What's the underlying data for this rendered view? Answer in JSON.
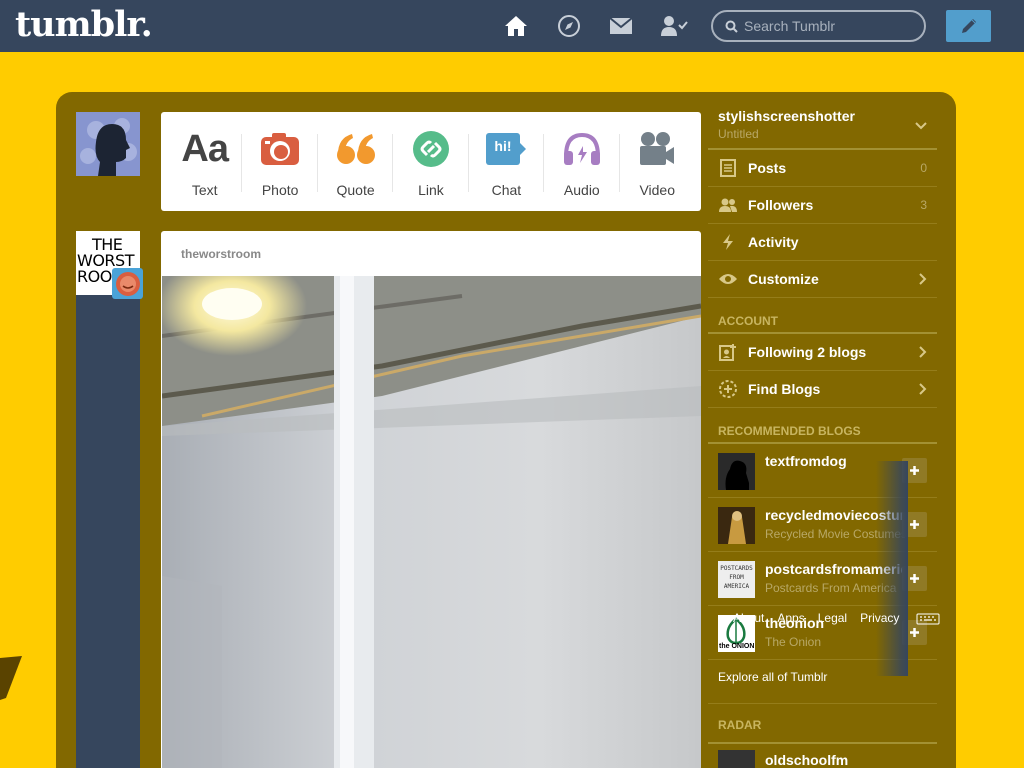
{
  "header": {
    "logo": "tumblr.",
    "search_placeholder": "Search Tumblr"
  },
  "post_types": [
    {
      "label": "Text",
      "color": "#444444"
    },
    {
      "label": "Photo",
      "color": "#d95e40"
    },
    {
      "label": "Quote",
      "color": "#f2992e"
    },
    {
      "label": "Link",
      "color": "#56bc8a"
    },
    {
      "label": "Chat",
      "color": "#529ecc"
    },
    {
      "label": "Audio",
      "color": "#a77dc2"
    },
    {
      "label": "Video",
      "color": "#748089"
    }
  ],
  "post_type_glyphs": {
    "text": "Aa",
    "chat": "hi!"
  },
  "blog_avatar_text": [
    "THE",
    "WORST",
    "ROO"
  ],
  "post": {
    "blog_name": "theworstroom"
  },
  "sidebar": {
    "account_name": "stylishscreenshotter",
    "account_sub": "Untitled",
    "rows": [
      {
        "label": "Posts",
        "count": "0"
      },
      {
        "label": "Followers",
        "count": "3"
      },
      {
        "label": "Activity",
        "count": ""
      },
      {
        "label": "Customize",
        "count": ""
      }
    ],
    "account_title": "ACCOUNT",
    "account_rows": [
      {
        "label": "Following 2 blogs"
      },
      {
        "label": "Find Blogs"
      }
    ],
    "recommended_title": "RECOMMENDED BLOGS",
    "recommended": [
      {
        "name": "textfromdog",
        "sub": ""
      },
      {
        "name": "recycledmoviecostumes",
        "sub": "Recycled Movie Costumes"
      },
      {
        "name": "postcardsfromamerica",
        "sub": "Postcards From America"
      },
      {
        "name": "theonion",
        "sub": "The Onion"
      }
    ],
    "postcard_thumb_text": [
      "POSTCARDS",
      "FROM",
      "AMERICA"
    ],
    "onion_thumb_text": "the ONION",
    "explore": "Explore all of Tumblr",
    "radar_title": "RADAR",
    "radar_item": "oldschoolfm"
  },
  "footer": {
    "links": [
      "About",
      "Apps",
      "Legal",
      "Privacy"
    ]
  },
  "colors": {
    "header": "#36465d",
    "background": "#ffcc00",
    "dashboard": "#826800",
    "compose": "#529ecc"
  }
}
